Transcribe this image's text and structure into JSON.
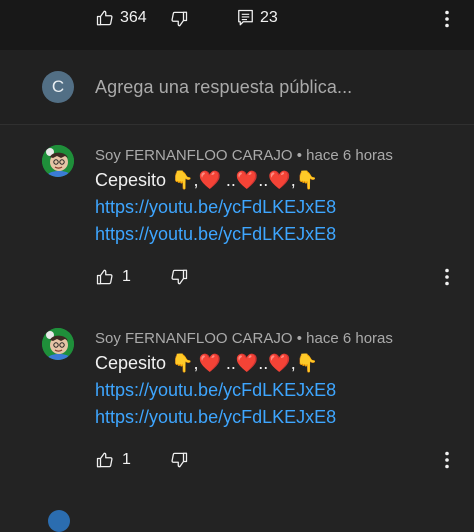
{
  "top": {
    "like_count": "364",
    "reply_count": "23"
  },
  "reply_box": {
    "avatar_letter": "C",
    "placeholder": "Agrega una respuesta pública..."
  },
  "comments": [
    {
      "author": "Soy FERNANFLOO CARAJO",
      "separator": "•",
      "time": "hace 6 horas",
      "text": "Cepesito 👇,❤️ ..❤️..❤️,👇",
      "links": [
        "https://youtu.be/ycFdLKEJxE8",
        "https://youtu.be/ycFdLKEJxE8"
      ],
      "likes": "1"
    },
    {
      "author": "Soy FERNANFLOO CARAJO",
      "separator": "•",
      "time": "hace 6 horas",
      "text": "Cepesito 👇,❤️ ..❤️..❤️,👇",
      "links": [
        "https://youtu.be/ycFdLKEJxE8",
        "https://youtu.be/ycFdLKEJxE8"
      ],
      "likes": "1"
    }
  ],
  "icons": {
    "like": "thumbs-up-icon",
    "dislike": "thumbs-down-icon",
    "replies": "comment-icon",
    "more": "more-vert-icon"
  },
  "colors": {
    "link": "#3ea6ff",
    "meta": "#aaaaaa",
    "background": "#232323",
    "top_bar": "#181818",
    "avatar_c": "#526f85"
  }
}
